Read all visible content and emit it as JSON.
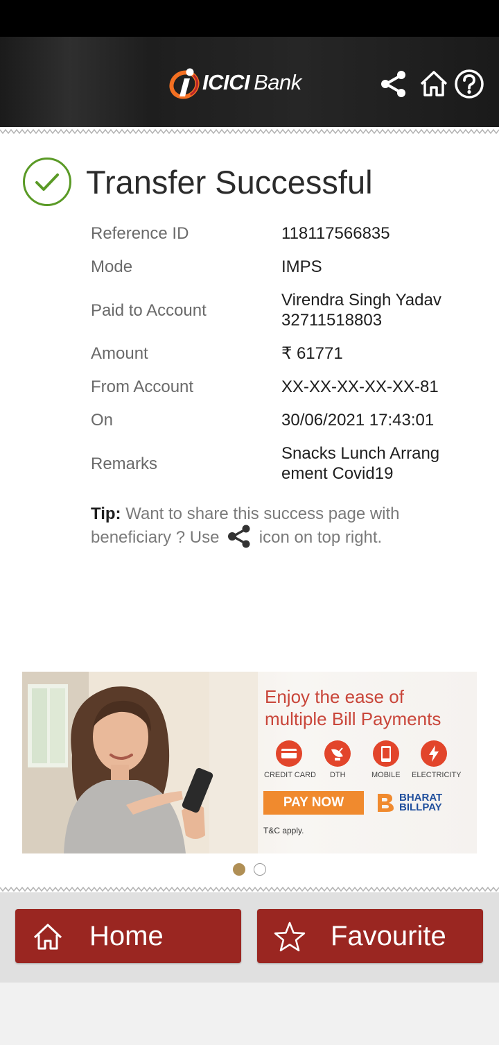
{
  "header": {
    "brand_icici": "ICICI",
    "brand_bank": "Bank",
    "icons": [
      "share-icon",
      "home-icon",
      "help-icon"
    ]
  },
  "status": {
    "title": "Transfer Successful",
    "icon": "check-circle-icon",
    "color": "#5a9a26"
  },
  "details": [
    {
      "label": "Reference ID",
      "value": "118117566835"
    },
    {
      "label": "Mode",
      "value": "IMPS"
    },
    {
      "label": "Paid to Account",
      "value": "Virendra Singh Yadav",
      "value2": "32711518803"
    },
    {
      "label": "Amount",
      "value": "₹ 61771"
    },
    {
      "label": "From Account",
      "value": "XX-XX-XX-XX-XX-81"
    },
    {
      "label": "On",
      "value": "30/06/2021 17:43:01"
    },
    {
      "label": "Remarks",
      "value": "Snacks Lunch Arrang",
      "value2": "ement Covid19"
    }
  ],
  "tip": {
    "bold": "Tip:",
    "text_before": "Want to share this success page with beneficiary ? Use",
    "text_after": "icon on top right."
  },
  "banner": {
    "title_line1": "Enjoy the ease of",
    "title_line2": "multiple Bill Payments",
    "categories": [
      "CREDIT CARD",
      "DTH",
      "MOBILE",
      "ELECTRICITY"
    ],
    "cta": "PAY NOW",
    "partner_line1": "BHARAT",
    "partner_line2": "BILLPAY",
    "terms": "T&C apply.",
    "slide_count": 2,
    "active_slide": 1
  },
  "footer": {
    "home_label": "Home",
    "favourite_label": "Favourite"
  },
  "colors": {
    "footer_button": "#9a2621",
    "header_bg": "#1e1e1e",
    "success_green": "#5a9a26",
    "logo_orange": "#f36f21"
  }
}
